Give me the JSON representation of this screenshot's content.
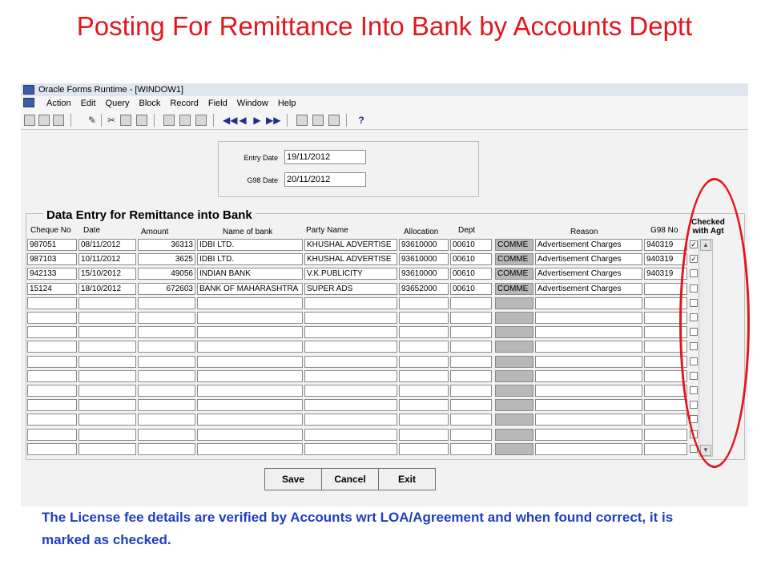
{
  "slide_title": "Posting For  Remittance Into Bank by Accounts Deptt",
  "window": {
    "title": "Oracle Forms Runtime - [WINDOW1]"
  },
  "menu": [
    "Action",
    "Edit",
    "Query",
    "Block",
    "Record",
    "Field",
    "Window",
    "Help"
  ],
  "toolbar_icons": [
    "save-icon",
    "print-icon",
    "print-setup-icon",
    "clear-icon",
    "cut-icon",
    "copy-icon",
    "paste-icon",
    "query-icon",
    "execute-query-icon",
    "cancel-query-icon",
    "first-record-icon",
    "previous-record-icon",
    "next-record-icon",
    "last-record-icon",
    "insert-record-icon",
    "delete-record-icon",
    "lock-record-icon",
    "help-icon"
  ],
  "dates": {
    "entry_date_label": "Entry Date",
    "entry_date": "19/11/2012",
    "g98_date_label": "G98 Date",
    "g98_date": "20/11/2012"
  },
  "block_title": "Data Entry for Remittance into Bank",
  "columns": [
    "Cheque No",
    "Date",
    "Amount",
    "Name  of bank",
    "Party Name",
    "Allocation",
    "Dept",
    "Reason",
    "G98 No",
    "Checked with Agt"
  ],
  "rows": [
    {
      "cheque_no": "987051",
      "date": "08/11/2012",
      "amount": "36313",
      "bank": "IDBI LTD.",
      "party": "KHUSHAL ADVERTISE",
      "allocation": "93610000",
      "dept": "00610",
      "comment": "COMME",
      "reason": "Advertisement Charges",
      "g98_no": "940319",
      "checked": true
    },
    {
      "cheque_no": "987103",
      "date": "10/11/2012",
      "amount": "3625",
      "bank": "IDBI LTD.",
      "party": "KHUSHAL ADVERTISE",
      "allocation": "93610000",
      "dept": "00610",
      "comment": "COMME",
      "reason": "Advertisement Charges",
      "g98_no": "940319",
      "checked": true
    },
    {
      "cheque_no": "942133",
      "date": "15/10/2012",
      "amount": "49056",
      "bank": "INDIAN BANK",
      "party": "V.K.PUBLICITY",
      "allocation": "93610000",
      "dept": "00610",
      "comment": "COMME",
      "reason": "Advertisement Charges",
      "g98_no": "940319",
      "checked": false
    },
    {
      "cheque_no": "15124",
      "date": "18/10/2012",
      "amount": "672603",
      "bank": "BANK OF MAHARASHTRA",
      "party": "SUPER ADS",
      "allocation": "93652000",
      "dept": "00610",
      "comment": "COMME",
      "reason": "Advertisement Charges",
      "g98_no": "",
      "checked": false
    }
  ],
  "buttons": {
    "save": "Save",
    "cancel": "Cancel",
    "exit": "Exit"
  },
  "caption": "The License fee details are verified by Accounts wrt LOA/Agreement and when found correct, it is marked as checked.",
  "colors": {
    "title": "#e3161c",
    "caption": "#1e3fbf",
    "highlight": "#e3161c"
  }
}
